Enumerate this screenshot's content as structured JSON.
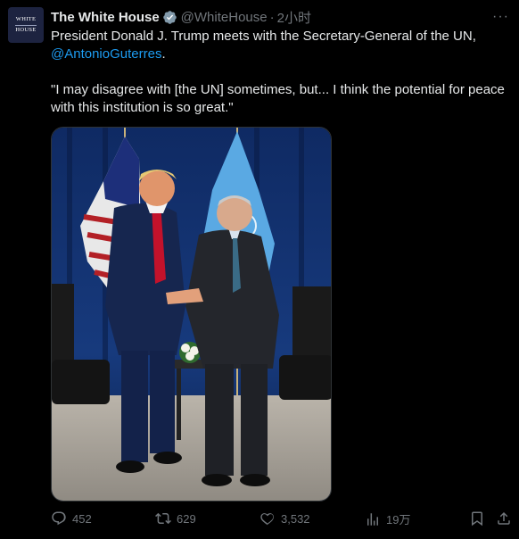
{
  "tweet": {
    "author_name": "The White House",
    "handle": "@WhiteHouse",
    "separator": "·",
    "time": "2小时",
    "avatar_line1": "WHITE",
    "avatar_line2": "HOUSE",
    "text_line1": "President Donald J. Trump meets with the Secretary-General of the UN,",
    "mention": "@AntonioGuterres",
    "mention_suffix": ".",
    "quote": "\"I may disagree with [the UN] sometimes, but... I think the potential for peace with this institution is so great.\"",
    "more": "···",
    "verified_icon": "verified-badge-icon",
    "colors": {
      "background": "#000000",
      "text": "#e7e9ea",
      "muted": "#71767b",
      "link": "#1d9bf0",
      "verified": "#829aab"
    }
  },
  "actions": {
    "replies": "452",
    "reposts": "629",
    "likes": "3,532",
    "views": "19万",
    "icons": [
      "reply-icon",
      "repost-icon",
      "like-icon",
      "views-icon",
      "bookmark-icon",
      "share-icon"
    ]
  }
}
